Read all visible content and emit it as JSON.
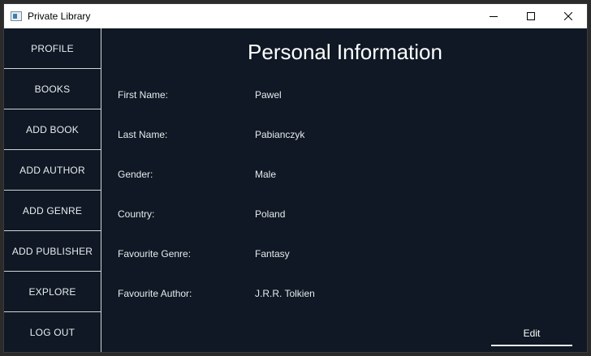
{
  "window": {
    "title": "Private Library"
  },
  "sidebar": {
    "items": [
      {
        "label": "PROFILE"
      },
      {
        "label": "BOOKS"
      },
      {
        "label": "ADD BOOK"
      },
      {
        "label": "ADD AUTHOR"
      },
      {
        "label": "ADD GENRE"
      },
      {
        "label": "ADD PUBLISHER"
      },
      {
        "label": "EXPLORE"
      },
      {
        "label": "LOG OUT"
      }
    ]
  },
  "main": {
    "title": "Personal Information",
    "fields": [
      {
        "label": "First Name:",
        "value": "Pawel"
      },
      {
        "label": "Last Name:",
        "value": "Pabianczyk"
      },
      {
        "label": "Gender:",
        "value": "Male"
      },
      {
        "label": "Country:",
        "value": "Poland"
      },
      {
        "label": "Favourite Genre:",
        "value": "Fantasy"
      },
      {
        "label": "Favourite Author:",
        "value": "J.R.R. Tolkien"
      }
    ],
    "edit_label": "Edit"
  },
  "colors": {
    "background": "#0f1824",
    "text": "#e6eaee",
    "divider": "#d0d4d8"
  },
  "icons": {
    "app": "window-app-icon",
    "minimize": "minimize-icon",
    "maximize": "maximize-icon",
    "close": "close-icon"
  }
}
